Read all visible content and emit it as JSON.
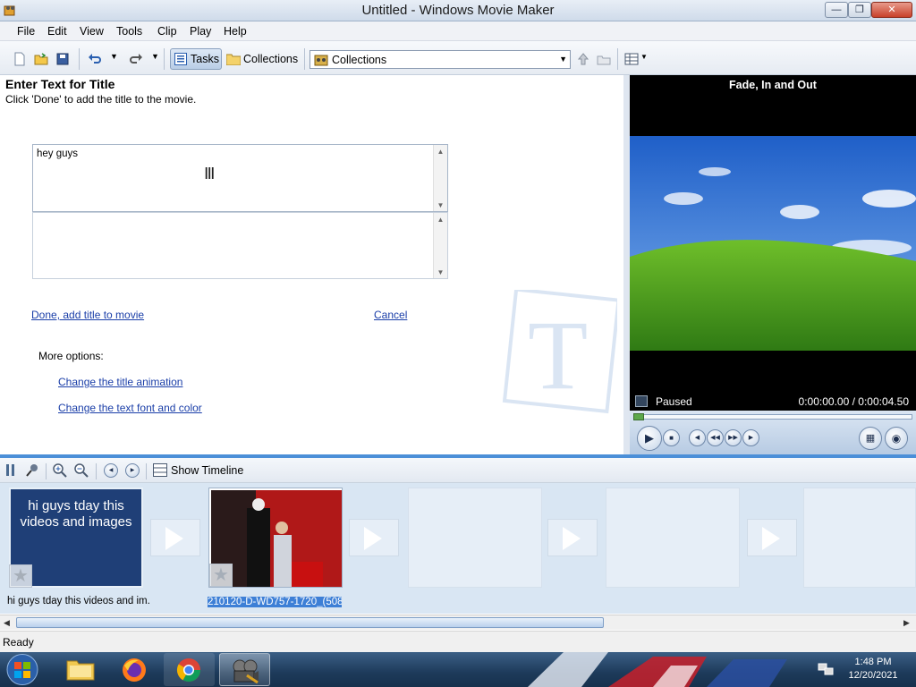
{
  "window": {
    "title": "Untitled - Windows Movie Maker"
  },
  "menu": [
    "File",
    "Edit",
    "View",
    "Tools",
    "Clip",
    "Play",
    "Help"
  ],
  "toolbar": {
    "tasks_label": "Tasks",
    "collections_label": "Collections",
    "collections_select": "Collections"
  },
  "task": {
    "heading": "Enter Text for Title",
    "instruction": "Click 'Done' to add the title to the movie.",
    "title_text": "hey guys",
    "done_link": "Done, add title to movie",
    "cancel_link": "Cancel",
    "more_options": "More options:",
    "animation_link": "Change the title animation",
    "font_link": "Change the text font and color"
  },
  "preview": {
    "title": "Fade, In and Out",
    "state": "Paused",
    "time": "0:00:00.00 / 0:00:04.50",
    "progress": 0
  },
  "storyboard": {
    "show_timeline": "Show Timeline",
    "clips": [
      {
        "thumb_text": "hi guys tday this videos and images",
        "caption": "hi guys tday this videos and im..."
      },
      {
        "caption": "210120-D-WD757-1720_(508..."
      }
    ]
  },
  "status": {
    "text": "Ready"
  },
  "taskbar": {
    "time": "1:48 PM",
    "date": "12/20/2021"
  },
  "colors": {
    "accent": "#4b8fd8",
    "link": "#1a3ea8",
    "title_card": "#1f3f77"
  }
}
